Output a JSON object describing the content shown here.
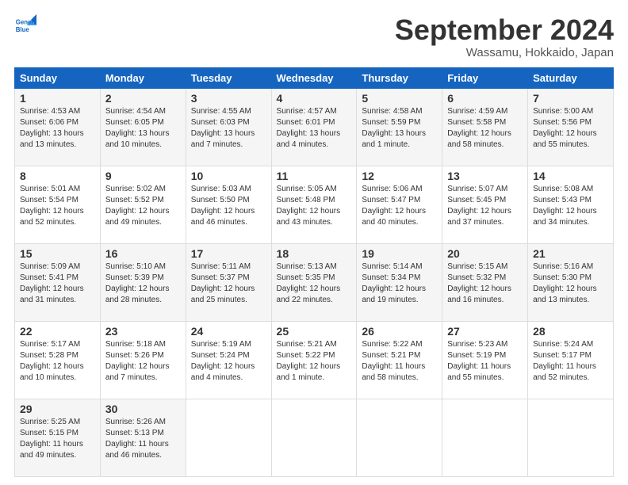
{
  "logo": {
    "line1": "General",
    "line2": "Blue"
  },
  "title": "September 2024",
  "location": "Wassamu, Hokkaido, Japan",
  "headers": [
    "Sunday",
    "Monday",
    "Tuesday",
    "Wednesday",
    "Thursday",
    "Friday",
    "Saturday"
  ],
  "weeks": [
    [
      {
        "day": "1",
        "text": "Sunrise: 4:53 AM\nSunset: 6:06 PM\nDaylight: 13 hours\nand 13 minutes."
      },
      {
        "day": "2",
        "text": "Sunrise: 4:54 AM\nSunset: 6:05 PM\nDaylight: 13 hours\nand 10 minutes."
      },
      {
        "day": "3",
        "text": "Sunrise: 4:55 AM\nSunset: 6:03 PM\nDaylight: 13 hours\nand 7 minutes."
      },
      {
        "day": "4",
        "text": "Sunrise: 4:57 AM\nSunset: 6:01 PM\nDaylight: 13 hours\nand 4 minutes."
      },
      {
        "day": "5",
        "text": "Sunrise: 4:58 AM\nSunset: 5:59 PM\nDaylight: 13 hours\nand 1 minute."
      },
      {
        "day": "6",
        "text": "Sunrise: 4:59 AM\nSunset: 5:58 PM\nDaylight: 12 hours\nand 58 minutes."
      },
      {
        "day": "7",
        "text": "Sunrise: 5:00 AM\nSunset: 5:56 PM\nDaylight: 12 hours\nand 55 minutes."
      }
    ],
    [
      {
        "day": "8",
        "text": "Sunrise: 5:01 AM\nSunset: 5:54 PM\nDaylight: 12 hours\nand 52 minutes."
      },
      {
        "day": "9",
        "text": "Sunrise: 5:02 AM\nSunset: 5:52 PM\nDaylight: 12 hours\nand 49 minutes."
      },
      {
        "day": "10",
        "text": "Sunrise: 5:03 AM\nSunset: 5:50 PM\nDaylight: 12 hours\nand 46 minutes."
      },
      {
        "day": "11",
        "text": "Sunrise: 5:05 AM\nSunset: 5:48 PM\nDaylight: 12 hours\nand 43 minutes."
      },
      {
        "day": "12",
        "text": "Sunrise: 5:06 AM\nSunset: 5:47 PM\nDaylight: 12 hours\nand 40 minutes."
      },
      {
        "day": "13",
        "text": "Sunrise: 5:07 AM\nSunset: 5:45 PM\nDaylight: 12 hours\nand 37 minutes."
      },
      {
        "day": "14",
        "text": "Sunrise: 5:08 AM\nSunset: 5:43 PM\nDaylight: 12 hours\nand 34 minutes."
      }
    ],
    [
      {
        "day": "15",
        "text": "Sunrise: 5:09 AM\nSunset: 5:41 PM\nDaylight: 12 hours\nand 31 minutes."
      },
      {
        "day": "16",
        "text": "Sunrise: 5:10 AM\nSunset: 5:39 PM\nDaylight: 12 hours\nand 28 minutes."
      },
      {
        "day": "17",
        "text": "Sunrise: 5:11 AM\nSunset: 5:37 PM\nDaylight: 12 hours\nand 25 minutes."
      },
      {
        "day": "18",
        "text": "Sunrise: 5:13 AM\nSunset: 5:35 PM\nDaylight: 12 hours\nand 22 minutes."
      },
      {
        "day": "19",
        "text": "Sunrise: 5:14 AM\nSunset: 5:34 PM\nDaylight: 12 hours\nand 19 minutes."
      },
      {
        "day": "20",
        "text": "Sunrise: 5:15 AM\nSunset: 5:32 PM\nDaylight: 12 hours\nand 16 minutes."
      },
      {
        "day": "21",
        "text": "Sunrise: 5:16 AM\nSunset: 5:30 PM\nDaylight: 12 hours\nand 13 minutes."
      }
    ],
    [
      {
        "day": "22",
        "text": "Sunrise: 5:17 AM\nSunset: 5:28 PM\nDaylight: 12 hours\nand 10 minutes."
      },
      {
        "day": "23",
        "text": "Sunrise: 5:18 AM\nSunset: 5:26 PM\nDaylight: 12 hours\nand 7 minutes."
      },
      {
        "day": "24",
        "text": "Sunrise: 5:19 AM\nSunset: 5:24 PM\nDaylight: 12 hours\nand 4 minutes."
      },
      {
        "day": "25",
        "text": "Sunrise: 5:21 AM\nSunset: 5:22 PM\nDaylight: 12 hours\nand 1 minute."
      },
      {
        "day": "26",
        "text": "Sunrise: 5:22 AM\nSunset: 5:21 PM\nDaylight: 11 hours\nand 58 minutes."
      },
      {
        "day": "27",
        "text": "Sunrise: 5:23 AM\nSunset: 5:19 PM\nDaylight: 11 hours\nand 55 minutes."
      },
      {
        "day": "28",
        "text": "Sunrise: 5:24 AM\nSunset: 5:17 PM\nDaylight: 11 hours\nand 52 minutes."
      }
    ],
    [
      {
        "day": "29",
        "text": "Sunrise: 5:25 AM\nSunset: 5:15 PM\nDaylight: 11 hours\nand 49 minutes."
      },
      {
        "day": "30",
        "text": "Sunrise: 5:26 AM\nSunset: 5:13 PM\nDaylight: 11 hours\nand 46 minutes."
      },
      {
        "day": "",
        "text": ""
      },
      {
        "day": "",
        "text": ""
      },
      {
        "day": "",
        "text": ""
      },
      {
        "day": "",
        "text": ""
      },
      {
        "day": "",
        "text": ""
      }
    ]
  ]
}
